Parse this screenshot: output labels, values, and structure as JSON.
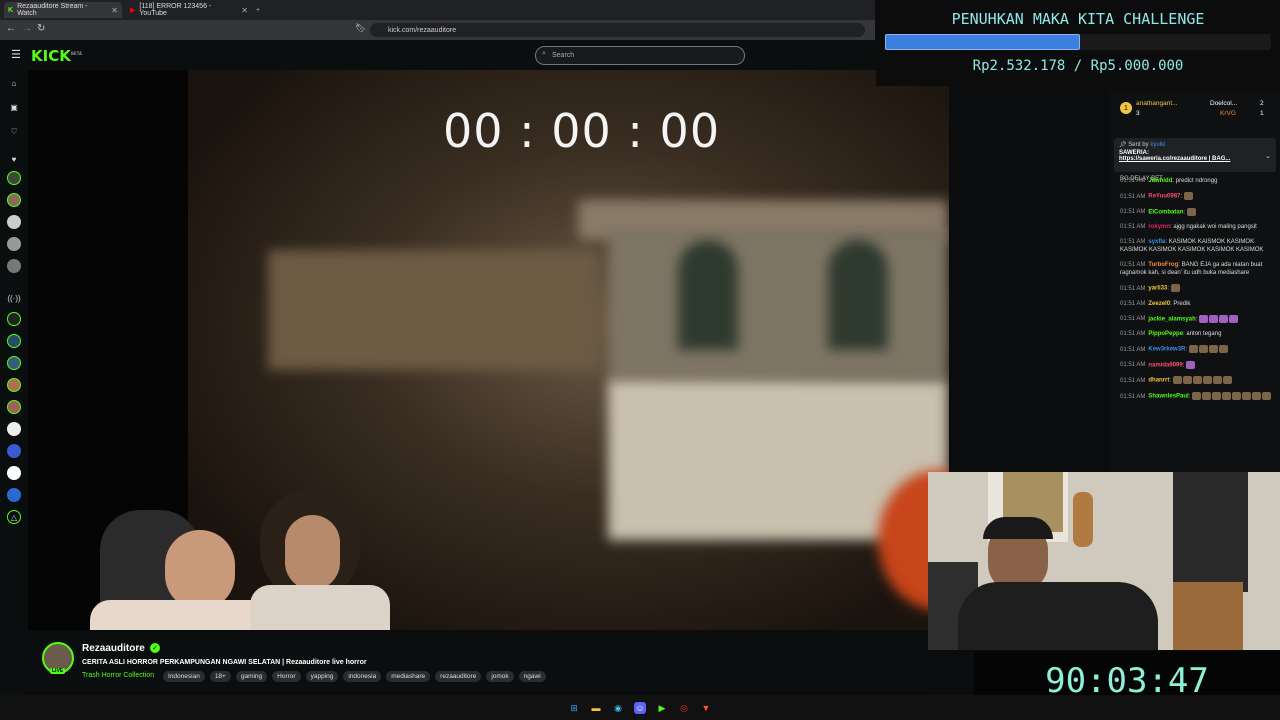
{
  "browser": {
    "tabs": [
      {
        "label": "Rezaauditore Stream - Watch",
        "active": true
      },
      {
        "label": "[118] ERROR 123456 - YouTube",
        "active": false
      }
    ],
    "url": "kick.com/rezaauditore"
  },
  "nav": {
    "logo": "KICK",
    "logo_sup": "BETA",
    "search_placeholder": "Search"
  },
  "video": {
    "timer": "00 : 00 : 00"
  },
  "challenge": {
    "title": "PENUHKAN MAKA KITA CHALLENGE",
    "amount": "Rp2.532.178 / Rp5.000.000",
    "progress": 0.506
  },
  "chat": {
    "top_donors": [
      {
        "name": "anathangant...",
        "count": "3"
      },
      {
        "name": "Doelcol...",
        "count": "2"
      },
      {
        "name": "KrVG",
        "count": "1"
      }
    ],
    "pinned": {
      "sent_by": "Sent by",
      "sender": "kyulki",
      "label": "SAWERIA:",
      "text": "https://saweria.co/rezaauditore | BAG..."
    },
    "partial": "BG DELAY BET",
    "messages": [
      {
        "time": "01:51 AM",
        "user": "Jawhidd",
        "color": "#53fc18",
        "text": "predict ndrongg",
        "emotes": 0
      },
      {
        "time": "01:51 AM",
        "user": "ReYuu0987",
        "color": "#ff4d6a",
        "text": "",
        "emotes": 1
      },
      {
        "time": "01:51 AM",
        "user": "ElCombatan",
        "color": "#53fc18",
        "text": "",
        "emotes": 1
      },
      {
        "time": "01:51 AM",
        "user": "rokymn",
        "color": "#e0245e",
        "text": "ajgg ngakak woi maling pangsit",
        "emotes": 0
      },
      {
        "time": "01:51 AM",
        "user": "syxfla",
        "color": "#3b8eea",
        "text": "KASIMOK KAISMOK KASIMOK KASIMOK KASIMOK KASIMOK KASIMOK KASIMOK",
        "emotes": 0
      },
      {
        "time": "01:51 AM",
        "user": "TurboFrog",
        "color": "#f58a3c",
        "text": "BANG EJA ga ada niatan buat ragnamok kah, si dean' itu udh buka mediashare",
        "emotes": 0
      },
      {
        "time": "01:51 AM",
        "user": "yarli33",
        "color": "#f5c542",
        "text": "",
        "emotes": 1
      },
      {
        "time": "01:51 AM",
        "user": "Zeezel0",
        "color": "#f5c542",
        "text": "Predik",
        "emotes": 0
      },
      {
        "time": "01:51 AM",
        "user": "jackie_alamsyah",
        "color": "#53fc18",
        "text": "",
        "emotes": 4,
        "purple": true
      },
      {
        "time": "01:51 AM",
        "user": "PippoPeppe",
        "color": "#53fc18",
        "text": "anton tegang",
        "emotes": 0
      },
      {
        "time": "01:51 AM",
        "user": "Kew3rkew3R",
        "color": "#3b8eea",
        "text": "",
        "emotes": 4
      },
      {
        "time": "01:51 AM",
        "user": "namida9099",
        "color": "#ff4d6a",
        "text": "",
        "emotes": 1,
        "purple": true
      },
      {
        "time": "01:51 AM",
        "user": "dhanrrt",
        "color": "#f5c542",
        "text": "",
        "emotes": 6
      },
      {
        "time": "01:51 AM",
        "user": "ShawnlesPaul",
        "color": "#53fc18",
        "text": "",
        "emotes": 8
      }
    ]
  },
  "countdown": "90:03:47",
  "channel": {
    "name": "Rezaauditore",
    "live": "LIVE",
    "title": "CERITA ASLI HORROR PERKAMPUNGAN NGAWI SELATAN | Rezaauditore live horror",
    "category": "Trash Horror Collection",
    "tags": [
      "Indonesian",
      "18+",
      "gaming",
      "Horror",
      "yapping",
      "indonesia",
      "mediashare",
      "rezaauditore",
      "jomok",
      "ngawi"
    ]
  }
}
